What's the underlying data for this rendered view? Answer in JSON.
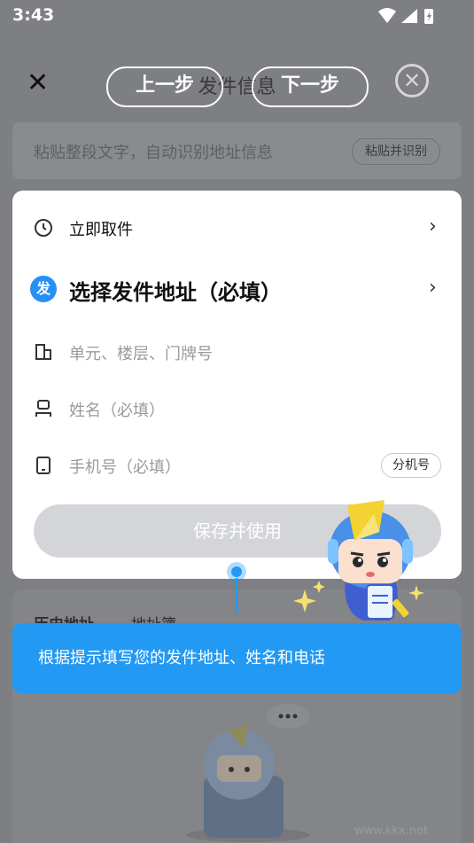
{
  "status_bar": {
    "time": "3:43"
  },
  "header": {
    "title": "发件信息",
    "prev_label": "上一步",
    "next_label": "下一步"
  },
  "paste": {
    "hint": "粘贴整段文字，自动识别地址信息",
    "button_label": "粘贴并识别"
  },
  "form": {
    "pickup_label": "立即取件",
    "sender_badge": "发",
    "address_label": "选择发件地址（必填）",
    "unit_placeholder": "单元、楼层、门牌号",
    "name_placeholder": "姓名（必填）",
    "phone_placeholder": "手机号（必填）",
    "extension_label": "分机号",
    "save_label": "保存并使用"
  },
  "lower_tabs": {
    "history": "历史地址",
    "book": "地址簿"
  },
  "tip": {
    "text": "根据提示填写您的发件地址、姓名和电话"
  },
  "watermark": "www.kkx.net",
  "colors": {
    "accent": "#2299f3",
    "badge": "#2690f5"
  }
}
